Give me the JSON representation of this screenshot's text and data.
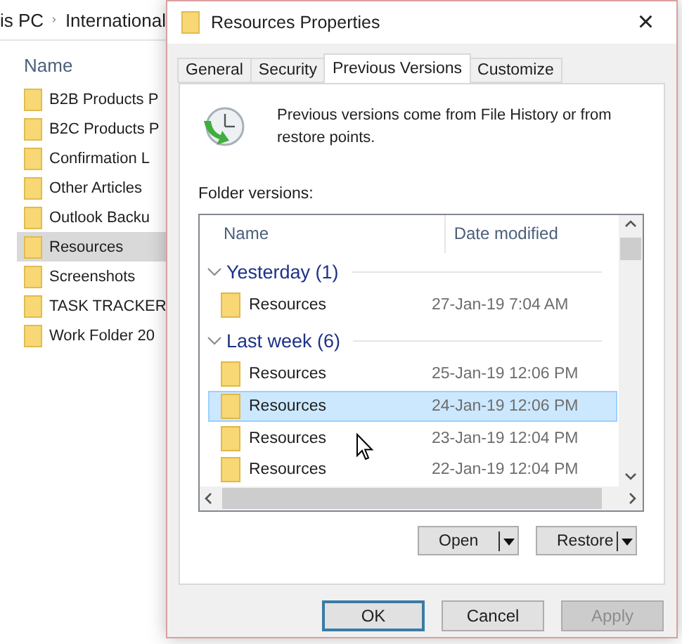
{
  "explorer": {
    "breadcrumb": [
      "is PC",
      "International"
    ],
    "column_header": "Name",
    "items": [
      {
        "name": "B2B Products P",
        "selected": false
      },
      {
        "name": "B2C Products P",
        "selected": false
      },
      {
        "name": "Confirmation L",
        "selected": false
      },
      {
        "name": "Other Articles",
        "selected": false
      },
      {
        "name": "Outlook Backu",
        "selected": false
      },
      {
        "name": "Resources",
        "selected": true
      },
      {
        "name": "Screenshots",
        "selected": false
      },
      {
        "name": "TASK TRACKER",
        "selected": false
      },
      {
        "name": "Work Folder 20",
        "selected": false
      }
    ]
  },
  "dialog": {
    "title": "Resources Properties",
    "close": "×",
    "tabs": [
      {
        "label": "General",
        "selected": false
      },
      {
        "label": "Security",
        "selected": false
      },
      {
        "label": "Previous Versions",
        "selected": true
      },
      {
        "label": "Customize",
        "selected": false
      }
    ],
    "info": "Previous versions come from File History or from restore points.",
    "list_label": "Folder versions:",
    "columns": [
      "Name",
      "Date modified"
    ],
    "groups": [
      {
        "title": "Yesterday (1)",
        "expanded": true,
        "rows": [
          {
            "name": "Resources",
            "date": "27-Jan-19 7:04 AM",
            "selected": false
          }
        ]
      },
      {
        "title": "Last week (6)",
        "expanded": true,
        "rows": [
          {
            "name": "Resources",
            "date": "25-Jan-19 12:06 PM",
            "selected": false
          },
          {
            "name": "Resources",
            "date": "24-Jan-19 12:06 PM",
            "selected": true
          },
          {
            "name": "Resources",
            "date": "23-Jan-19 12:04 PM",
            "selected": false
          },
          {
            "name": "Resources",
            "date": "22-Jan-19 12:04 PM",
            "selected": false
          }
        ]
      }
    ],
    "split_buttons": [
      "Open",
      "Restore"
    ],
    "buttons": [
      {
        "label": "OK",
        "kind": "default",
        "disabled": false
      },
      {
        "label": "Cancel",
        "kind": "normal",
        "disabled": false
      },
      {
        "label": "Apply",
        "kind": "normal",
        "disabled": true
      }
    ]
  }
}
